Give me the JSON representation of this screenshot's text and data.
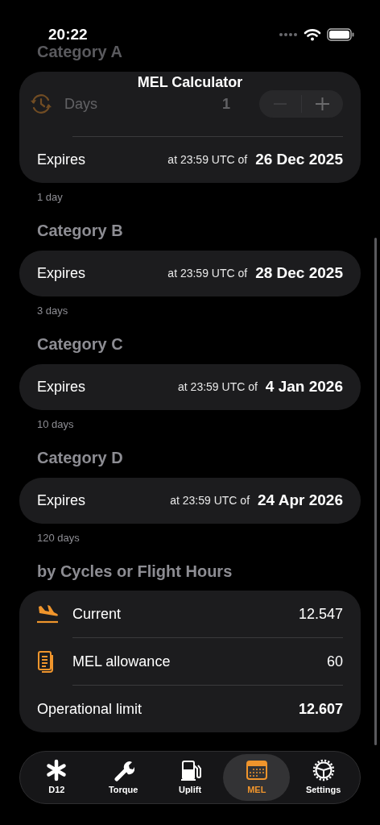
{
  "status_bar": {
    "time": "20:22"
  },
  "nav": {
    "title": "MEL Calculator"
  },
  "categories": [
    {
      "title": "Category A",
      "days": {
        "label": "Days",
        "value": "1"
      },
      "expires_label": "Expires",
      "time_note": "at 23:59 UTC of",
      "date": "26 Dec 2025",
      "footnote": "1 day"
    },
    {
      "title": "Category B",
      "expires_label": "Expires",
      "time_note": "at 23:59 UTC of",
      "date": "28 Dec 2025",
      "footnote": "3 days"
    },
    {
      "title": "Category C",
      "expires_label": "Expires",
      "time_note": "at 23:59 UTC of",
      "date": "4 Jan 2026",
      "footnote": "10 days"
    },
    {
      "title": "Category D",
      "expires_label": "Expires",
      "time_note": "at 23:59 UTC of",
      "date": "24 Apr 2026",
      "footnote": "120 days"
    }
  ],
  "cycles": {
    "title": "by Cycles or Flight Hours",
    "rows": [
      {
        "kind": "current",
        "label": "Current",
        "value": "12.547"
      },
      {
        "kind": "allowance",
        "label": "MEL allowance",
        "value": "60"
      },
      {
        "kind": "limit",
        "label": "Operational limit",
        "value": "12.607"
      }
    ]
  },
  "tabs": [
    {
      "kind": "asterisk",
      "label": "D12",
      "selected": false
    },
    {
      "kind": "wrench",
      "label": "Torque",
      "selected": false
    },
    {
      "kind": "fuel",
      "label": "Uplift",
      "selected": false
    },
    {
      "kind": "calendar",
      "label": "MEL",
      "selected": true
    },
    {
      "kind": "gear",
      "label": "Settings",
      "selected": false
    }
  ]
}
